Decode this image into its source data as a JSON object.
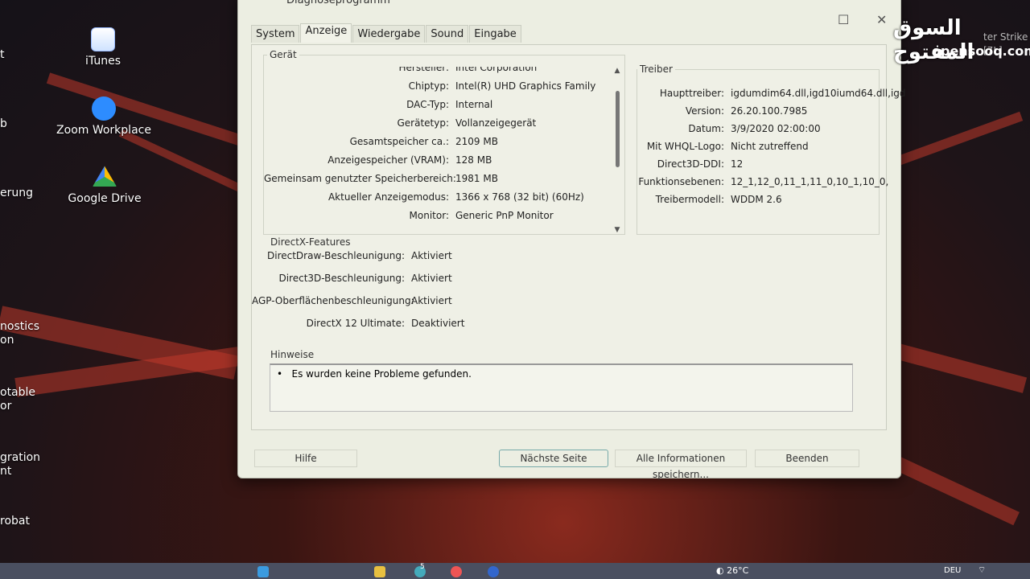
{
  "desktop": {
    "icons": [
      {
        "label": "iTunes",
        "icon": "itunes-icon"
      },
      {
        "label": "Zoom Workplace",
        "icon": "zoom-icon"
      },
      {
        "label": "Google Drive",
        "icon": "google-drive-icon"
      }
    ],
    "cut_labels": [
      "t",
      "b",
      "erung",
      "nostics\non",
      "otable\nor",
      "gration\nnt",
      "robat"
    ],
    "top_right_icon_label": "ter Strike\n[7L]"
  },
  "watermark": {
    "arabic": "السوق المفتوح",
    "latin": "opensooq.com"
  },
  "window": {
    "title": "Diagnoseprogramm",
    "tabs": [
      "System",
      "Anzeige",
      "Wiedergabe",
      "Sound",
      "Eingabe"
    ],
    "active_tab": "Anzeige",
    "device": {
      "label": "Gerät",
      "rows": [
        {
          "k": "Hersteller:",
          "v": "Intel Corporation"
        },
        {
          "k": "Chiptyp:",
          "v": "Intel(R) UHD Graphics Family"
        },
        {
          "k": "DAC-Typ:",
          "v": "Internal"
        },
        {
          "k": "Gerätetyp:",
          "v": "Vollanzeigegerät"
        },
        {
          "k": "Gesamtspeicher ca.:",
          "v": "2109 MB"
        },
        {
          "k": "Anzeigespeicher (VRAM):",
          "v": "128 MB"
        },
        {
          "k": "Gemeinsam genutzter Speicherbereich:",
          "v": "1981 MB"
        },
        {
          "k": "Aktueller Anzeigemodus:",
          "v": "1366 x 768 (32 bit) (60Hz)"
        },
        {
          "k": "Monitor:",
          "v": "Generic PnP Monitor"
        }
      ]
    },
    "driver": {
      "label": "Treiber",
      "rows": [
        {
          "k": "Haupttreiber:",
          "v": "igdumdim64.dll,igd10iumd64.dll,igd"
        },
        {
          "k": "Version:",
          "v": "26.20.100.7985"
        },
        {
          "k": "Datum:",
          "v": "3/9/2020 02:00:00"
        },
        {
          "k": "Mit WHQL-Logo:",
          "v": "Nicht zutreffend"
        },
        {
          "k": "Direct3D-DDI:",
          "v": "12"
        },
        {
          "k": "Funktionsebenen:",
          "v": "12_1,12_0,11_1,11_0,10_1,10_0,"
        },
        {
          "k": "Treibermodell:",
          "v": "WDDM 2.6"
        }
      ]
    },
    "directx": {
      "label": "DirectX-Features",
      "rows": [
        {
          "k": "DirectDraw-Beschleunigung:",
          "v": "Aktiviert"
        },
        {
          "k": "Direct3D-Beschleunigung:",
          "v": "Aktiviert"
        },
        {
          "k": "AGP-Oberflächenbeschleunigung:",
          "v": "Aktiviert"
        },
        {
          "k": "DirectX 12 Ultimate:",
          "v": "Deaktiviert"
        }
      ]
    },
    "notes": {
      "label": "Hinweise",
      "items": [
        "Es wurden keine Probleme gefunden."
      ]
    },
    "buttons": {
      "help": "Hilfe",
      "next": "Nächste Seite",
      "save_all": "Alle Informationen speichern...",
      "exit": "Beenden"
    }
  },
  "taskbar": {
    "weather": "26°C",
    "badge": "5",
    "lang": "DEU"
  }
}
